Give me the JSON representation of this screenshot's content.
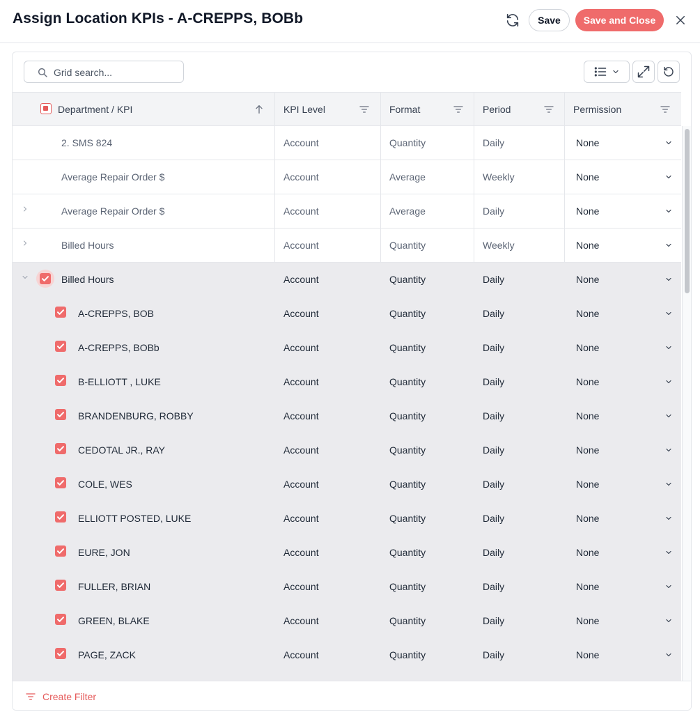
{
  "dialog": {
    "title": "Assign Location KPIs - A-CREPPS, BOBb",
    "save_label": "Save",
    "save_close_label": "Save and Close",
    "accent_color": "#ef6b6b"
  },
  "toolbar": {
    "search_placeholder": "Grid search...",
    "icons": [
      "search-icon",
      "columns-list-icon",
      "chevron-down-icon",
      "expand-icon",
      "reset-icon"
    ]
  },
  "columns": [
    {
      "label": "Department / KPI",
      "icon": "sort-ascending-icon"
    },
    {
      "label": "KPI Level",
      "icon": "filter-icon"
    },
    {
      "label": "Format",
      "icon": "filter-icon"
    },
    {
      "label": "Period",
      "icon": "filter-icon"
    },
    {
      "label": "Permission",
      "icon": "filter-icon"
    }
  ],
  "rows": [
    {
      "name": "2. SMS 824",
      "level": "Account",
      "format": "Quantity",
      "period": "Daily",
      "permission": "None",
      "expander": "none",
      "checked": false,
      "selected": false,
      "indent": 1
    },
    {
      "name": "Average Repair Order $",
      "level": "Account",
      "format": "Average",
      "period": "Weekly",
      "permission": "None",
      "expander": "none",
      "checked": false,
      "selected": false,
      "indent": 1
    },
    {
      "name": "Average Repair Order $",
      "level": "Account",
      "format": "Average",
      "period": "Daily",
      "permission": "None",
      "expander": "collapsed",
      "checked": false,
      "selected": false,
      "indent": 1
    },
    {
      "name": "Billed Hours",
      "level": "Account",
      "format": "Quantity",
      "period": "Weekly",
      "permission": "None",
      "expander": "collapsed",
      "checked": false,
      "selected": false,
      "indent": 1
    },
    {
      "name": "Billed Hours",
      "level": "Account",
      "format": "Quantity",
      "period": "Daily",
      "permission": "None",
      "expander": "expanded",
      "checked": true,
      "selected": true,
      "indent": 1
    },
    {
      "name": "A-CREPPS, BOB",
      "level": "Account",
      "format": "Quantity",
      "period": "Daily",
      "permission": "None",
      "expander": "none",
      "checked": true,
      "selected": true,
      "indent": 2
    },
    {
      "name": "A-CREPPS, BOBb",
      "level": "Account",
      "format": "Quantity",
      "period": "Daily",
      "permission": "None",
      "expander": "none",
      "checked": true,
      "selected": true,
      "indent": 2
    },
    {
      "name": "B-ELLIOTT , LUKE",
      "level": "Account",
      "format": "Quantity",
      "period": "Daily",
      "permission": "None",
      "expander": "none",
      "checked": true,
      "selected": true,
      "indent": 2
    },
    {
      "name": "BRANDENBURG, ROBBY",
      "level": "Account",
      "format": "Quantity",
      "period": "Daily",
      "permission": "None",
      "expander": "none",
      "checked": true,
      "selected": true,
      "indent": 2
    },
    {
      "name": "CEDOTAL JR., RAY",
      "level": "Account",
      "format": "Quantity",
      "period": "Daily",
      "permission": "None",
      "expander": "none",
      "checked": true,
      "selected": true,
      "indent": 2
    },
    {
      "name": "COLE, WES",
      "level": "Account",
      "format": "Quantity",
      "period": "Daily",
      "permission": "None",
      "expander": "none",
      "checked": true,
      "selected": true,
      "indent": 2
    },
    {
      "name": "ELLIOTT POSTED, LUKE",
      "level": "Account",
      "format": "Quantity",
      "period": "Daily",
      "permission": "None",
      "expander": "none",
      "checked": true,
      "selected": true,
      "indent": 2
    },
    {
      "name": "EURE, JON",
      "level": "Account",
      "format": "Quantity",
      "period": "Daily",
      "permission": "None",
      "expander": "none",
      "checked": true,
      "selected": true,
      "indent": 2
    },
    {
      "name": "FULLER, BRIAN",
      "level": "Account",
      "format": "Quantity",
      "period": "Daily",
      "permission": "None",
      "expander": "none",
      "checked": true,
      "selected": true,
      "indent": 2
    },
    {
      "name": "GREEN, BLAKE",
      "level": "Account",
      "format": "Quantity",
      "period": "Daily",
      "permission": "None",
      "expander": "none",
      "checked": true,
      "selected": true,
      "indent": 2
    },
    {
      "name": "PAGE, ZACK",
      "level": "Account",
      "format": "Quantity",
      "period": "Daily",
      "permission": "None",
      "expander": "none",
      "checked": true,
      "selected": true,
      "indent": 2
    },
    {
      "name": "",
      "level": "",
      "format": "",
      "period": "",
      "permission": "",
      "expander": "none",
      "checked": false,
      "selected": true,
      "indent": 2
    }
  ],
  "footer": {
    "create_filter_label": "Create Filter"
  }
}
